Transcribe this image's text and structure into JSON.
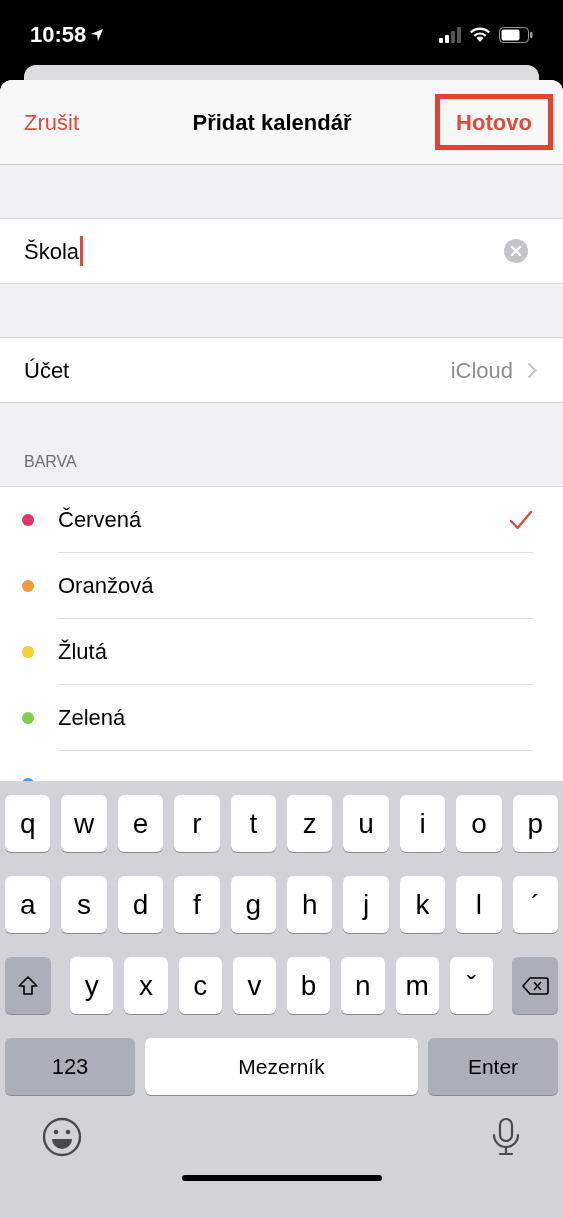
{
  "status_bar": {
    "time": "10:58"
  },
  "nav": {
    "cancel": "Zrušit",
    "title": "Přidat kalendář",
    "done": "Hotovo",
    "done_highlighted": true
  },
  "name_field": {
    "value": "Škola"
  },
  "account": {
    "label": "Účet",
    "value": "iCloud"
  },
  "color_section": {
    "header": "BARVA",
    "items": [
      {
        "label": "Červená",
        "color": "#e0356a",
        "selected": true
      },
      {
        "label": "Oranžová",
        "color": "#f09a37",
        "selected": false
      },
      {
        "label": "Žlutá",
        "color": "#f5cf32",
        "selected": false
      },
      {
        "label": "Zelená",
        "color": "#7ed04b",
        "selected": false
      },
      {
        "color": "#3d9cf0",
        "selected": false
      }
    ]
  },
  "keyboard": {
    "rows": [
      [
        {
          "kind": "letter",
          "label": "q"
        },
        {
          "kind": "letter",
          "label": "w"
        },
        {
          "kind": "letter",
          "label": "e"
        },
        {
          "kind": "letter",
          "label": "r"
        },
        {
          "kind": "letter",
          "label": "t"
        },
        {
          "kind": "letter",
          "label": "z"
        },
        {
          "kind": "letter",
          "label": "u"
        },
        {
          "kind": "letter",
          "label": "i"
        },
        {
          "kind": "letter",
          "label": "o"
        },
        {
          "kind": "letter",
          "label": "p"
        }
      ],
      [
        {
          "kind": "letter",
          "label": "a"
        },
        {
          "kind": "letter",
          "label": "s"
        },
        {
          "kind": "letter",
          "label": "d"
        },
        {
          "kind": "letter",
          "label": "f"
        },
        {
          "kind": "letter",
          "label": "g"
        },
        {
          "kind": "letter",
          "label": "h"
        },
        {
          "kind": "letter",
          "label": "j"
        },
        {
          "kind": "letter",
          "label": "k"
        },
        {
          "kind": "letter",
          "label": "l"
        },
        {
          "kind": "letter",
          "label": "´"
        }
      ],
      [
        {
          "kind": "shift"
        },
        {
          "kind": "letter",
          "label": "y"
        },
        {
          "kind": "letter",
          "label": "x"
        },
        {
          "kind": "letter",
          "label": "c"
        },
        {
          "kind": "letter",
          "label": "v"
        },
        {
          "kind": "letter",
          "label": "b"
        },
        {
          "kind": "letter",
          "label": "n"
        },
        {
          "kind": "letter",
          "label": "m"
        },
        {
          "kind": "letter",
          "label": "ˇ"
        },
        {
          "kind": "delete"
        }
      ]
    ],
    "bottom_row": {
      "numbers": "123",
      "space": "Mezerník",
      "enter": "Enter"
    }
  }
}
